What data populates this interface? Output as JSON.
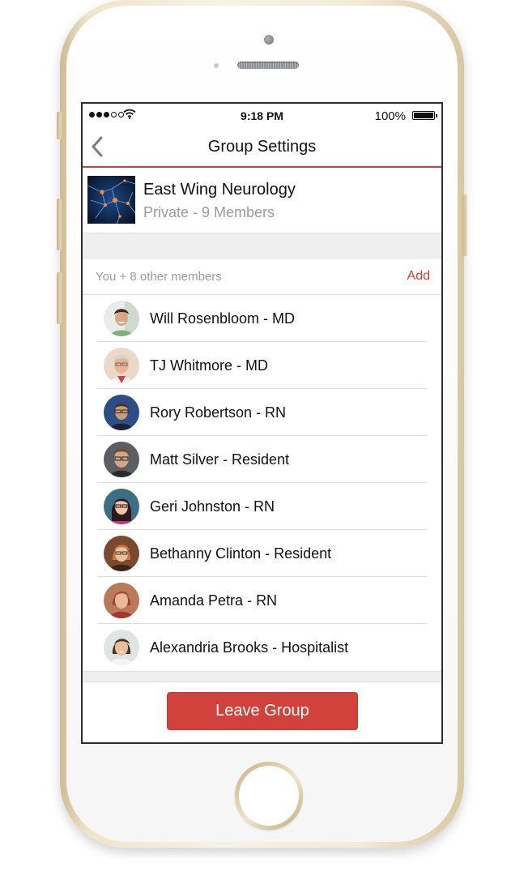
{
  "status_bar": {
    "time": "9:18 PM",
    "battery": "100%",
    "signal_bars_filled": 3,
    "signal_bars_total": 5,
    "battery_level": 1.0
  },
  "nav": {
    "title": "Group Settings",
    "back_icon": "chevron-left-icon"
  },
  "group": {
    "name": "East Wing Neurology",
    "subtitle": "Private - 9 Members"
  },
  "members_section": {
    "count_label": "You + 8 other members",
    "add_label": "Add"
  },
  "members": [
    {
      "name": "Will Rosenbloom - MD"
    },
    {
      "name": "TJ Whitmore - MD"
    },
    {
      "name": "Rory Robertson - RN"
    },
    {
      "name": "Matt Silver - Resident"
    },
    {
      "name": "Geri Johnston - RN"
    },
    {
      "name": "Bethanny Clinton - Resident"
    },
    {
      "name": "Amanda Petra - RN"
    },
    {
      "name": "Alexandria Brooks - Hospitalist"
    }
  ],
  "actions": {
    "leave_label": "Leave Group"
  },
  "colors": {
    "accent": "#d2423c",
    "nav_rule": "#c94040",
    "secondary_text": "#9b9b9b",
    "phone_gold": "#efe4cc"
  }
}
